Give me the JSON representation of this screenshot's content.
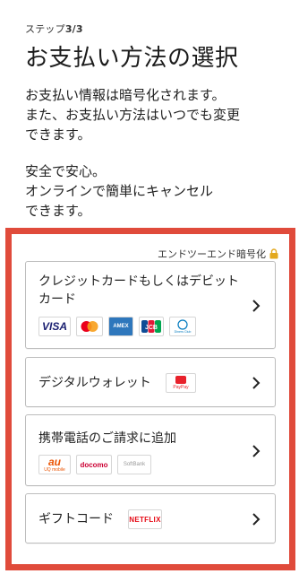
{
  "header": {
    "step_prefix": "ステップ",
    "step_value": "3/3",
    "title": "お支払い方法の選択"
  },
  "info": {
    "line1": "お支払い情報は暗号化されます。",
    "line2": "また、お支払い方法はいつでも変更",
    "line3": "できます。",
    "line4": "安全で安心。",
    "line5": "オンラインで簡単にキャンセル",
    "line6": "できます。"
  },
  "security": {
    "label": "エンドツーエンド暗号化",
    "icon": "lock-icon"
  },
  "options": [
    {
      "label_line1": "クレジットカードもしくはデビット",
      "label_line2": "カード",
      "logos": [
        "VISA",
        "Mastercard",
        "AMEX",
        "JCB",
        "Diners Club"
      ]
    },
    {
      "label_line1": "デジタルウォレット",
      "logos": [
        "PayPay"
      ]
    },
    {
      "label_line1": "携帯電話のご請求に追加",
      "logos": [
        "au",
        "docomo",
        "SoftBank"
      ]
    },
    {
      "label_line1": "ギフトコード",
      "logos": [
        "NETFLIX"
      ]
    }
  ],
  "logo_text": {
    "visa": "VISA",
    "amex": "AMEX",
    "jcb": "JCB",
    "diners": "Diners Club",
    "paypay": "PayPay",
    "au_a": "au",
    "au_b": "UQ mobile",
    "docomo": "docomo",
    "softbank": "SoftBank",
    "netflix": "NETFLIX"
  },
  "colors": {
    "highlight_border": "#e04b3b",
    "option_border": "#bdbdbd",
    "lock": "#e3a81c"
  }
}
